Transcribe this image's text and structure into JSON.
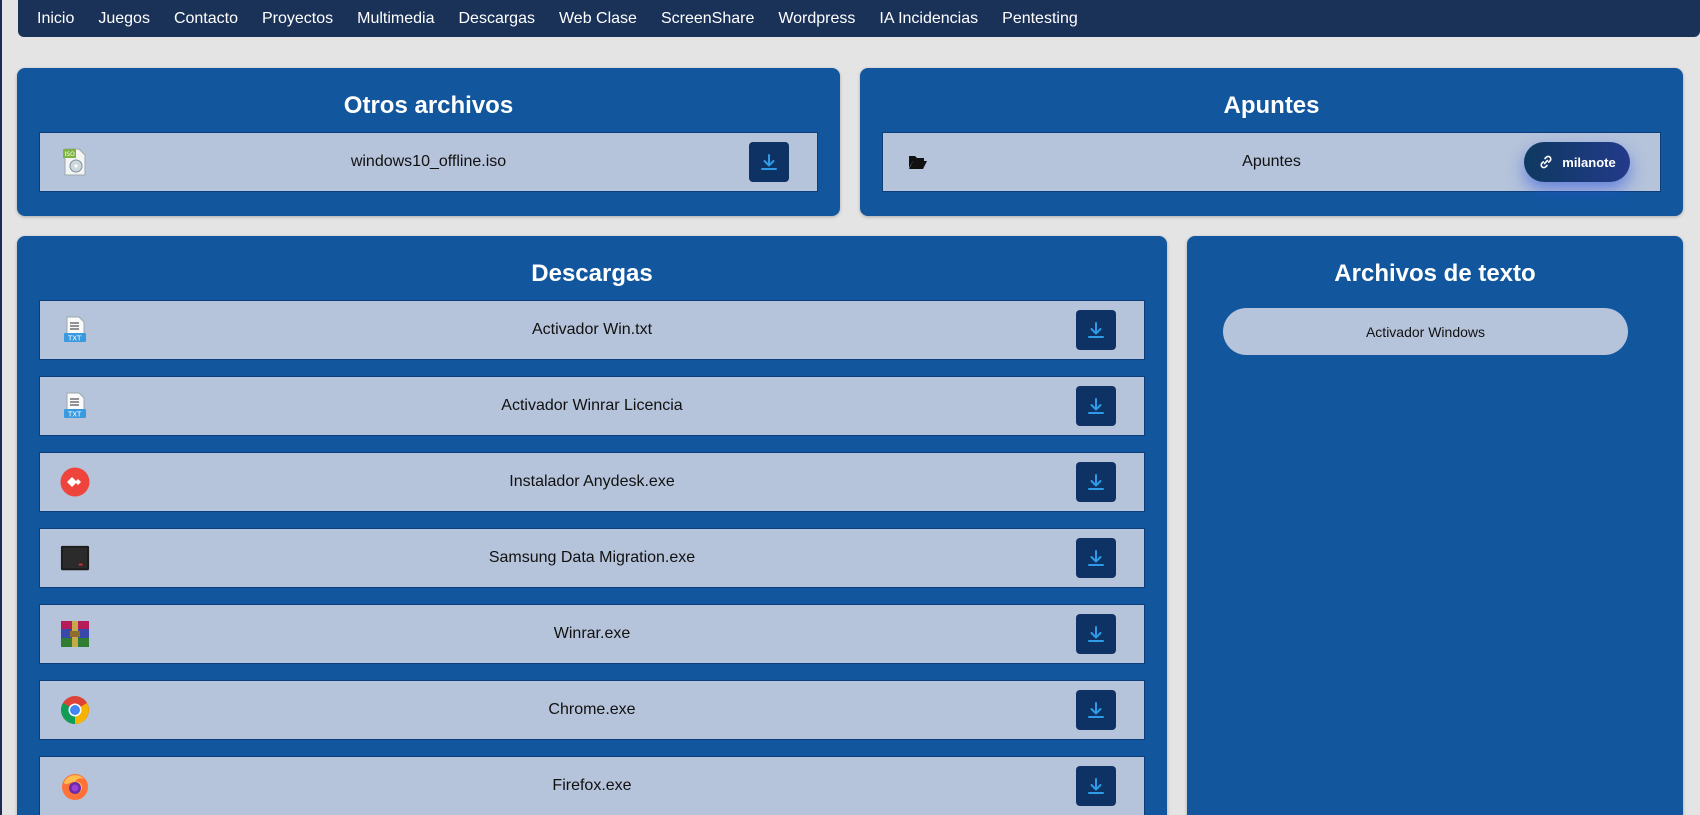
{
  "nav": {
    "items": [
      {
        "label": "Inicio"
      },
      {
        "label": "Juegos"
      },
      {
        "label": "Contacto"
      },
      {
        "label": "Proyectos"
      },
      {
        "label": "Multimedia"
      },
      {
        "label": "Descargas"
      },
      {
        "label": "Web Clase"
      },
      {
        "label": "ScreenShare"
      },
      {
        "label": "Wordpress"
      },
      {
        "label": "IA Incidencias"
      },
      {
        "label": "Pentesting"
      }
    ]
  },
  "otros": {
    "title": "Otros archivos",
    "files": [
      {
        "name": "windows10_offline.iso",
        "icon": "iso-file-icon"
      }
    ]
  },
  "apuntes": {
    "title": "Apuntes",
    "item": {
      "name": "Apuntes",
      "icon": "folder-open-icon",
      "link_label": "milanote"
    }
  },
  "descargas": {
    "title": "Descargas",
    "files": [
      {
        "name": "Activador Win.txt",
        "icon": "txt-file-icon"
      },
      {
        "name": "Activador Winrar Licencia",
        "icon": "txt-file-icon"
      },
      {
        "name": "Instalador Anydesk.exe",
        "icon": "anydesk-icon"
      },
      {
        "name": "Samsung Data Migration.exe",
        "icon": "samsung-ssd-icon"
      },
      {
        "name": "Winrar.exe",
        "icon": "winrar-icon"
      },
      {
        "name": "Chrome.exe",
        "icon": "chrome-icon"
      },
      {
        "name": "Firefox.exe",
        "icon": "firefox-icon"
      }
    ]
  },
  "texto": {
    "title": "Archivos de texto",
    "items": [
      {
        "label": "Activador Windows"
      }
    ]
  },
  "colors": {
    "page_bg": "#e4e4e4",
    "nav_bg": "#1a3258",
    "panel_bg": "#12579e",
    "row_bg": "#b5c3db",
    "button_bg": "#0d3263",
    "button_icon": "#2f9be8"
  }
}
